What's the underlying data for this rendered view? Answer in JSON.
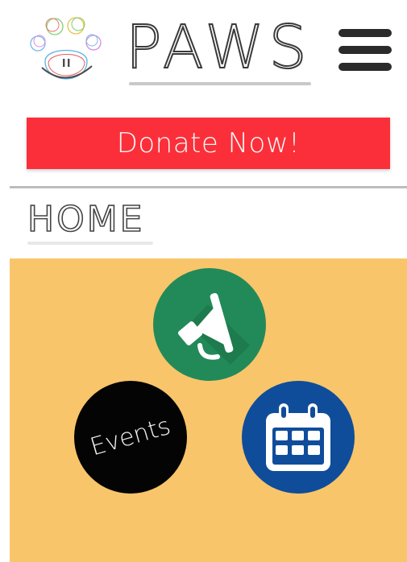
{
  "app": {
    "brand_name": "PAWS",
    "colors": {
      "donate": "#fb2f3a",
      "panel": "#f9c56a",
      "announcements": "#228a58",
      "events": "#040404",
      "calendar": "#0f4d9b"
    }
  },
  "header": {
    "logo_icon": "paw-logo-icon",
    "menu_icon": "hamburger-menu-icon"
  },
  "donate": {
    "label": "Donate Now!"
  },
  "page": {
    "title": "HOME"
  },
  "shortcuts": [
    {
      "icon": "megaphone-icon"
    },
    {
      "label": "Events"
    },
    {
      "icon": "calendar-icon"
    }
  ]
}
